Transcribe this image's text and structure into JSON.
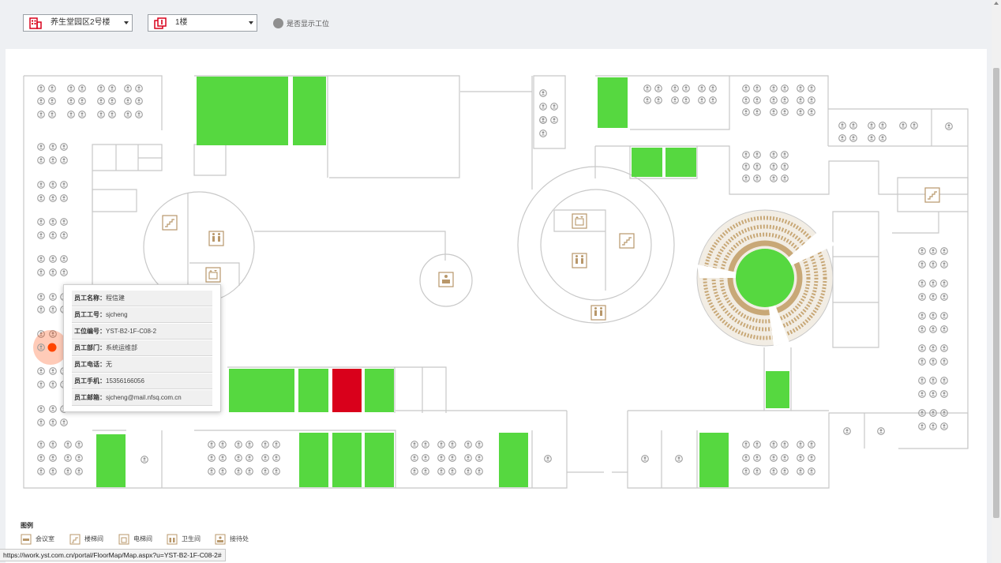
{
  "toolbar": {
    "building_select": {
      "value": "养生堂园区2号楼",
      "icon": "building-icon"
    },
    "floor_select": {
      "value": "1楼",
      "icon": "floor-icon"
    },
    "toggle_label": "是否显示工位"
  },
  "colors": {
    "room_free": "#56d840",
    "room_busy": "#d9001b",
    "selected_seat": "#ff4500",
    "wall": "#c8c8c8",
    "seat_icon": "#9a9a9a",
    "facility_icon": "#b8976a"
  },
  "tooltip": {
    "rows": [
      {
        "label": "员工名称：",
        "value": "程信建"
      },
      {
        "label": "员工工号：",
        "value": "sjcheng"
      },
      {
        "label": "工位编号：",
        "value": "YST-B2-1F-C08-2"
      },
      {
        "label": "员工部门：",
        "value": "系统运维部"
      },
      {
        "label": "员工电话：",
        "value": "无"
      },
      {
        "label": "员工手机：",
        "value": "15356166056"
      },
      {
        "label": "员工邮箱：",
        "value": "sjcheng@mail.nfsq.com.cn"
      }
    ]
  },
  "legend": {
    "title": "图例",
    "items": [
      {
        "label": "会议室",
        "icon": "meeting-room-icon"
      },
      {
        "label": "楼梯间",
        "icon": "stairs-icon"
      },
      {
        "label": "电梯间",
        "icon": "elevator-icon"
      },
      {
        "label": "卫生间",
        "icon": "restroom-icon"
      },
      {
        "label": "接待处",
        "icon": "reception-icon"
      }
    ]
  },
  "statusbar": {
    "url": "https://iwork.yst.com.cn/portal/FloorMap/Map.aspx?u=YST-B2-1F-C08-2#"
  }
}
